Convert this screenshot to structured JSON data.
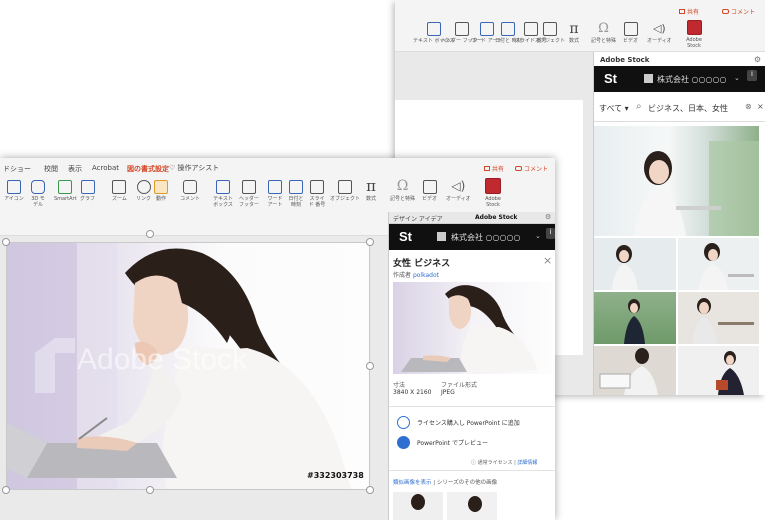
{
  "back_window": {
    "share_button": "共有",
    "comments_button": "コメント",
    "ribbon_tools": [
      {
        "label": "テキスト ボックス",
        "icon": "textbox-icon"
      },
      {
        "label": "ヘッダー フッター",
        "icon": "header-footer-icon"
      },
      {
        "label": "ワード アート",
        "icon": "wordart-icon"
      },
      {
        "label": "日付と 時刻",
        "icon": "date-time-icon"
      },
      {
        "label": "スライド 番号",
        "icon": "slide-number-icon"
      },
      {
        "label": "オブジェクト",
        "icon": "object-icon"
      },
      {
        "label": "数式",
        "icon": "equation-icon"
      },
      {
        "label": "記号と特殊",
        "icon": "symbol-icon"
      },
      {
        "label": "ビデオ",
        "icon": "video-icon"
      },
      {
        "label": "オーディオ",
        "icon": "audio-icon"
      },
      {
        "label": "Adobe Stock",
        "icon": "adobe-stock-icon"
      }
    ],
    "panel": {
      "title": "Adobe Stock",
      "logo": "St",
      "account": "株式会社 ○○○○○",
      "filter_label": "すべて",
      "search_value": "ビジネス、日本、女性"
    }
  },
  "front_window": {
    "tabs": [
      "ドショー",
      "校閲",
      "表示",
      "Acrobat",
      "図の書式設定",
      "操作アシスト"
    ],
    "share_button": "共有",
    "comments_button": "コメント",
    "ribbon_tools": [
      {
        "label": "アイコン",
        "icon": "icons-icon"
      },
      {
        "label": "3D モデル",
        "icon": "3d-model-icon"
      },
      {
        "label": "SmartArt",
        "icon": "smartart-icon"
      },
      {
        "label": "グラフ",
        "icon": "chart-icon"
      },
      {
        "label": "ズーム",
        "icon": "zoom-icon"
      },
      {
        "label": "リンク",
        "icon": "link-icon"
      },
      {
        "label": "動作",
        "icon": "action-icon"
      },
      {
        "label": "コメント",
        "icon": "comment-icon"
      },
      {
        "label": "テキスト ボックス",
        "icon": "textbox-icon"
      },
      {
        "label": "ヘッダー フッター",
        "icon": "header-footer-icon"
      },
      {
        "label": "ワード アート",
        "icon": "wordart-icon"
      },
      {
        "label": "日付と 時刻",
        "icon": "date-time-icon"
      },
      {
        "label": "スライド 番号",
        "icon": "slide-number-icon"
      },
      {
        "label": "オブジェクト",
        "icon": "object-icon"
      },
      {
        "label": "数式",
        "icon": "equation-icon"
      },
      {
        "label": "記号と特殊",
        "icon": "symbol-icon"
      },
      {
        "label": "ビデオ",
        "icon": "video-icon"
      },
      {
        "label": "オーディオ",
        "icon": "audio-icon"
      },
      {
        "label": "Adobe Stock",
        "icon": "adobe-stock-icon"
      }
    ],
    "watermark": "Adobe Stock",
    "asset_id": "#332303738",
    "panel": {
      "tab_design": "デザイン アイデア",
      "tab_stock": "Adobe Stock",
      "logo": "St",
      "account": "株式会社 ○○○○○",
      "title": "女性 ビジネス",
      "author_label": "作成者",
      "author_name": "polkadot",
      "size_label": "寸法",
      "size_value": "3840 X 2160",
      "format_label": "ファイル形式",
      "format_value": "JPEG",
      "license_action": "ライセンス購入し PowerPoint に追加",
      "preview_action": "PowerPoint でプレビュー",
      "license_info": "通常ライセンス",
      "details_link": "詳細情報",
      "similar_link": "類似画像を表示",
      "series_label": "シリーズのその他の画像"
    }
  },
  "colors": {
    "accent": "#d24726",
    "stock_header": "#101010",
    "link_blue": "#2e6fd1"
  }
}
